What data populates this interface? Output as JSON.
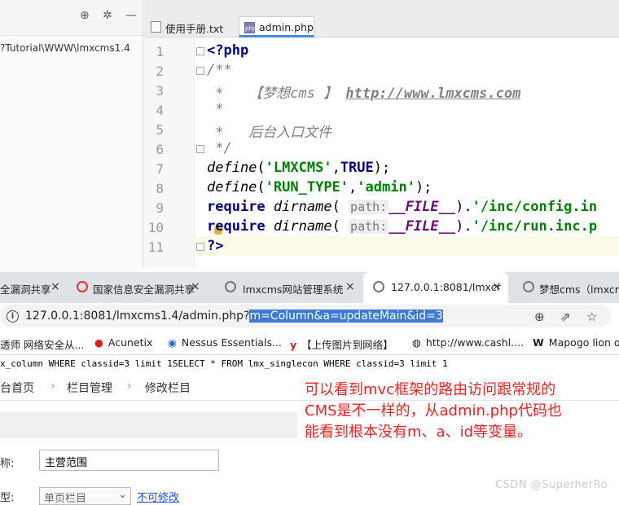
{
  "ide": {
    "project_path": "?Tutorial\\WWW\\lmxcms1.4",
    "toolbar_icons": [
      "globe-icon",
      "settings-icon",
      "minimize-icon"
    ],
    "tabs": [
      {
        "label": "使用手册.txt",
        "icon": "txt-file-icon",
        "active": false
      },
      {
        "label": "admin.php",
        "icon": "php-file-icon",
        "active": true
      }
    ],
    "line_numbers": [
      "1",
      "2",
      "3",
      "4",
      "5",
      "6",
      "7",
      "8",
      "9",
      "10",
      "11"
    ],
    "code": {
      "l1": "<?php",
      "l2": "/**",
      "l3_prefix": " *   ",
      "l3_brand": "【梦想cms 】",
      "l3_url": "http://www.lmxcms.com",
      "l4": " *",
      "l5_prefix": " *   ",
      "l5_text": "后台入口文件",
      "l6": " */",
      "l7_fn": "define",
      "l7_a": "'LMXCMS'",
      "l7_b": "TRUE",
      "l8_fn": "define",
      "l8_a": "'RUN_TYPE'",
      "l8_b": "'admin'",
      "l9_kw": "require",
      "l9_fn": "dirname",
      "hint": "path:",
      "file_const": "__FILE__",
      "l9_str": "'/inc/config.in",
      "l10_kw": "require",
      "l10_fn": "dirname",
      "l10_str": "'/inc/run.inc.p",
      "l11": "?>"
    }
  },
  "browser": {
    "tabs": [
      {
        "label": "全漏洞共享",
        "active": false
      },
      {
        "label": "国家信息安全漏洞共享",
        "active": false
      },
      {
        "label": "lmxcms网站管理系统",
        "active": false
      },
      {
        "label": "127.0.0.1:8081/lmxcr",
        "active": true
      },
      {
        "label": "梦想cms（lmxcm",
        "active": false
      }
    ],
    "close_glyph": "×",
    "address": {
      "plain": "127.0.0.1:8081/lmxcms1.4/admin.php?",
      "selected": "m=Column&a=updateMain&id=3"
    },
    "address_actions": [
      "zoom-icon",
      "share-icon",
      "star-icon"
    ],
    "bookmarks": [
      {
        "label": "透师 网络安全从...",
        "icon": "bookmark-icon"
      },
      {
        "label": "Acunetix",
        "icon": "acunetix-icon"
      },
      {
        "label": "Nessus Essentials...",
        "icon": "nessus-icon"
      },
      {
        "label": "【上传图片到网络】",
        "icon": "y-icon"
      },
      {
        "label": "http://www.cashl....",
        "icon": "globe-icon"
      },
      {
        "label": "Mapogo lion o",
        "icon": "w-icon"
      }
    ]
  },
  "page": {
    "sql_output": "x_column WHERE classid=3 limit 1SELECT * FROM lmx_singlecon WHERE classid=3 limit 1",
    "breadcrumb": [
      "台首页",
      "栏目管理",
      "修改栏目"
    ],
    "breadcrumb_sep": "›",
    "form": {
      "name_label": "称:",
      "name_value": "主营范围",
      "type_label": "型:",
      "type_value": "单页栏目",
      "type_note": "不可修改"
    },
    "annotation": [
      "可以看到mvc框架的路由访问跟常规的",
      "CMS是不一样的，从admin.php代码也",
      "能看到根本没有m、a、id等变量。"
    ],
    "watermark": "CSDN @SuperherRo"
  },
  "colors": {
    "annotation": "#ee2222",
    "selection": "#3d7ad6",
    "keyword": "#000080",
    "string": "#008000"
  }
}
